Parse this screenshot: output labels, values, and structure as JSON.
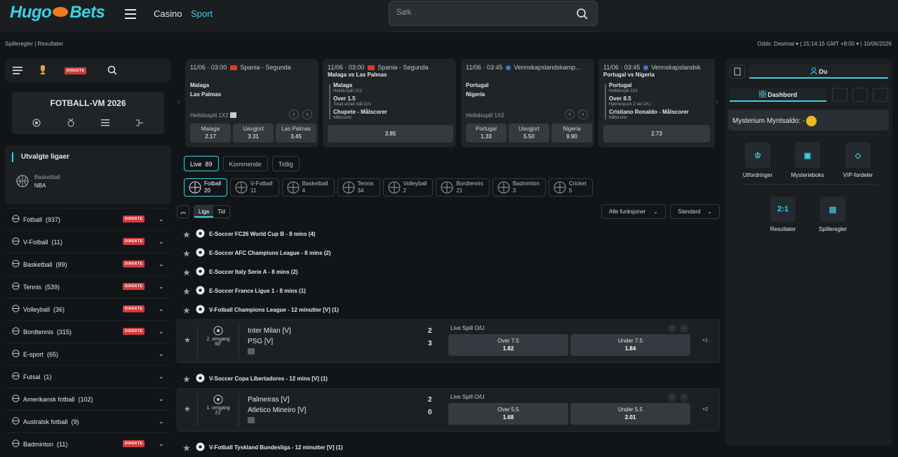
{
  "header": {
    "logo": "Hugo Bets",
    "nav": {
      "casino": "Casino",
      "sport": "Sport"
    },
    "search_placeholder": "Søk"
  },
  "subbar": {
    "left": "Spilleregler  |  Resultater",
    "right": "Odds: Desimal  ▾   |   15:14:15 GMT +8:00  ▾   |   10/06/2026"
  },
  "left": {
    "direkte": "DIREKTE",
    "vm_title": "FOTBALL-VM 2026",
    "selected": {
      "title": "Utvalgte ligaer",
      "sport": "Basketball",
      "league": "NBA"
    },
    "sports": [
      {
        "name": "Fotball",
        "count": "(937)",
        "live": true,
        "icon": "football-icon"
      },
      {
        "name": "V-Fotball",
        "count": "(11)",
        "live": true,
        "icon": "v-football-icon"
      },
      {
        "name": "Basketball",
        "count": "(89)",
        "live": true,
        "icon": "basketball-icon"
      },
      {
        "name": "Tennis",
        "count": "(539)",
        "live": true,
        "icon": "tennis-icon"
      },
      {
        "name": "Volleyball",
        "count": "(36)",
        "live": true,
        "icon": "volleyball-icon"
      },
      {
        "name": "Bordtennis",
        "count": "(315)",
        "live": true,
        "icon": "table-tennis-icon"
      },
      {
        "name": "E-sport",
        "count": "(65)",
        "live": false,
        "icon": "esport-icon"
      },
      {
        "name": "Futsal",
        "count": "(1)",
        "live": false,
        "icon": "futsal-icon"
      },
      {
        "name": "Amerikansk fotball",
        "count": "(102)",
        "live": false,
        "icon": "american-football-icon"
      },
      {
        "name": "Australsk fotball",
        "count": "(9)",
        "live": false,
        "icon": "aussie-rules-icon"
      },
      {
        "name": "Badminton",
        "count": "(11)",
        "live": true,
        "icon": "badminton-icon"
      }
    ]
  },
  "carousel": [
    {
      "head": "11/06 · 03:00",
      "league": "Spania - Segunda",
      "t1": "Malaga",
      "t2": "Las Palmas",
      "market": "Heltidsspill 1X2",
      "odds": [
        {
          "l": "Malaga",
          "v": "2.17"
        },
        {
          "l": "Uavgjort",
          "v": "3.31"
        },
        {
          "l": "Las Palmas",
          "v": "3.45"
        }
      ]
    },
    {
      "head": "11/06 · 03:00",
      "league": "Spania - Segunda",
      "title": "Malaga vs Las Palmas",
      "l1": "Malaga",
      "l1s": "Heltidsspill 1X2",
      "l2": "Over 1.5",
      "l2s": "Totalt antall mål O/U",
      "l3": "Chupete - Målscorer",
      "l3s": "Målscorer",
      "odd": "3.85"
    },
    {
      "head": "11/06 · 03:45",
      "league": "Vennskapslandskamp...",
      "t1": "Portugal",
      "t2": "Nigeria",
      "market": "Heltidsspill 1X2",
      "odds": [
        {
          "l": "Portugal",
          "v": "1.33"
        },
        {
          "l": "Uavgjort",
          "v": "5.50"
        },
        {
          "l": "Nigeria",
          "v": "9.90"
        }
      ]
    },
    {
      "head": "11/06 · 03:45",
      "league": "Vennskapslandsk",
      "title": "Portugal vs Nigeria",
      "l1": "Portugal",
      "l1s": "Heltidsspill 1X2",
      "l2": "Over 8.5",
      "l2s": "Hjørnespark 2 vei O/U",
      "l3": "Cristiano Ronaldo - Målscorer",
      "l3s": "Målscorer",
      "odd": "2.73"
    }
  ],
  "tabs": [
    {
      "label": "Live",
      "count": "89"
    },
    {
      "label": "Kommende"
    },
    {
      "label": "Tidlig"
    }
  ],
  "sport_chips": [
    {
      "name": "Fotball",
      "count": "20"
    },
    {
      "name": "V-Fotball",
      "count": "11"
    },
    {
      "name": "Basketball",
      "count": "4"
    },
    {
      "name": "Tennis",
      "count": "34"
    },
    {
      "name": "Volleyball",
      "count": "2"
    },
    {
      "name": "Bordtennis",
      "count": "21"
    },
    {
      "name": "Badminton",
      "count": "3"
    },
    {
      "name": "Cricket",
      "count": "5"
    }
  ],
  "filters": {
    "liga": "Liga",
    "tid": "Tid",
    "funksjoner": "Alle funksjoner",
    "standard": "Standard"
  },
  "leagues": [
    {
      "name": "E-Soccer FC26 World Cup B - 8 mins (4)"
    },
    {
      "name": "E-Soccer AFC Champions League - 8 mins (2)"
    },
    {
      "name": "E-Soccer Italy Serie A - 8 mins (2)"
    },
    {
      "name": "E-Soccer France Ligue 1 - 8 mins (1)"
    },
    {
      "name": "V-Fotball Champions League - 12 minutter [V] (1)"
    }
  ],
  "match1": {
    "period": "2. omgang",
    "time": "60'",
    "t1": "Inter Milan [V]",
    "t2": "PSG [V]",
    "s1": "2",
    "s2": "3",
    "market": "Live Spill O/U",
    "o1": "Over 7.5",
    "v1": "1.82",
    "o2": "Under 7.5",
    "v2": "1.84",
    "more": "+1"
  },
  "league6": "V-Soccer Copa Libertadores - 12 mins [V] (1)",
  "match2": {
    "period": "1. omgang",
    "time": "21'",
    "t1": "Palmeiras [V]",
    "t2": "Atletico Mineiro [V]",
    "s1": "2",
    "s2": "0",
    "market": "Live Spill O/U",
    "o1": "Over 5.5",
    "v1": "1.68",
    "o2": "Under 5.5",
    "v2": "2.01",
    "more": "+2"
  },
  "league7": "V-Fotball Tyskland Bundesliga - 12 minutter [V] (1)",
  "right": {
    "du": "Du",
    "dashboard": "Dashbord",
    "mysterium": "Mysterium Myntsaldo: -",
    "tiles": [
      "Utfordringer",
      "Mysterieboks",
      "VIP-fordeler",
      "Resultater",
      "Spilleregler"
    ],
    "score_icon": "2:1"
  },
  "colors": {
    "accent": "#39d2e4",
    "live": "#d23c3c",
    "bg": "#121518"
  }
}
